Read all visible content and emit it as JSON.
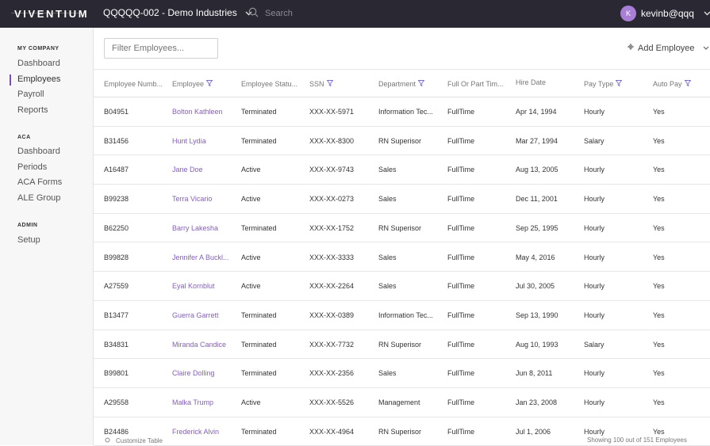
{
  "topbar": {
    "logo": "VIVENTIUM",
    "company": "QQQQQ-002 - Demo Industries",
    "search_placeholder": "Search",
    "user_initial": "K",
    "user_name": "kevinb@qqq"
  },
  "sidebar": {
    "sections": [
      {
        "label": "MY COMPANY",
        "items": [
          "Dashboard",
          "Employees",
          "Payroll",
          "Reports"
        ]
      },
      {
        "label": "ACA",
        "items": [
          "Dashboard",
          "Periods",
          "ACA Forms",
          "ALE Group"
        ]
      },
      {
        "label": "ADMIN",
        "items": [
          "Setup"
        ]
      }
    ],
    "active_item": "Employees"
  },
  "toolbar": {
    "filter_placeholder": "Filter Employees...",
    "add_employee": "Add Employee"
  },
  "table": {
    "columns": [
      "Employee Numb...",
      "Employee",
      "Employee Statu...",
      "SSN",
      "Department",
      "Full Or Part Tim...",
      "Hire Date",
      "Pay Type",
      "Auto Pay"
    ],
    "rows": [
      [
        "B04951",
        "Bolton Kathleen",
        "Terminated",
        "XXX-XX-5971",
        "Information Tec...",
        "FullTime",
        "Apr 14, 1994",
        "Hourly",
        "Yes"
      ],
      [
        "B31456",
        "Hunt Lydia",
        "Terminated",
        "XXX-XX-8300",
        "RN Superisor",
        "FullTime",
        "Mar 27, 1994",
        "Salary",
        "Yes"
      ],
      [
        "A16487",
        "Jane Doe",
        "Active",
        "XXX-XX-9743",
        "Sales",
        "FullTime",
        "Aug 13, 2005",
        "Hourly",
        "Yes"
      ],
      [
        "B99238",
        "Terra Vicario",
        "Active",
        "XXX-XX-0273",
        "Sales",
        "FullTime",
        "Dec 11, 2001",
        "Hourly",
        "Yes"
      ],
      [
        "B62250",
        "Barry Lakesha",
        "Terminated",
        "XXX-XX-1752",
        "RN Superisor",
        "FullTime",
        "Sep 25, 1995",
        "Hourly",
        "Yes"
      ],
      [
        "B99828",
        "Jennifer A Buckl...",
        "Active",
        "XXX-XX-3333",
        "Sales",
        "FullTime",
        "May 4, 2016",
        "Hourly",
        "Yes"
      ],
      [
        "A27559",
        "Eyal Kornblut",
        "Active",
        "XXX-XX-2264",
        "Sales",
        "FullTime",
        "Jul 30, 2005",
        "Hourly",
        "Yes"
      ],
      [
        "B13477",
        "Guerra Garrett",
        "Terminated",
        "XXX-XX-0389",
        "Information Tec...",
        "FullTime",
        "Sep 13, 1990",
        "Hourly",
        "Yes"
      ],
      [
        "B34831",
        "Miranda Candice",
        "Terminated",
        "XXX-XX-7732",
        "RN Superisor",
        "FullTime",
        "Aug 10, 1993",
        "Salary",
        "Yes"
      ],
      [
        "B99801",
        "Claire Dolling",
        "Terminated",
        "XXX-XX-2356",
        "Sales",
        "FullTime",
        "Jun 8, 2011",
        "Hourly",
        "Yes"
      ],
      [
        "A29558",
        "Malka Trump",
        "Active",
        "XXX-XX-5526",
        "Management",
        "FullTime",
        "Jan 23, 2008",
        "Hourly",
        "Yes"
      ],
      [
        "B24486",
        "Frederick Alvin",
        "Terminated",
        "XXX-XX-4964",
        "RN Superisor",
        "FullTime",
        "Jul 1, 2006",
        "Hourly",
        "Yes"
      ]
    ]
  },
  "footer": {
    "customize": "Customize Table",
    "showing": "Showing 100 out of 151 Employees"
  },
  "colors": {
    "topbar": "#2a2833",
    "accent": "#7b4fb8",
    "link": "#8560b9"
  }
}
